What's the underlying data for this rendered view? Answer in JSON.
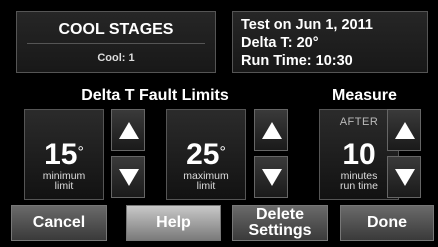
{
  "stages": {
    "title": "COOL STAGES",
    "subtitle": "Cool: 1"
  },
  "info": {
    "line1": "Test on Jun 1, 2011",
    "line2": "Delta T: 20°",
    "line3": "Run Time: 10:30"
  },
  "fault_limits": {
    "title": "Delta T Fault Limits",
    "min": {
      "value": "15",
      "unit": "°",
      "caption1": "minimum",
      "caption2": "limit"
    },
    "max": {
      "value": "25",
      "unit": "°",
      "caption1": "maximum",
      "caption2": "limit"
    }
  },
  "measure": {
    "title": "Measure",
    "prefix": "AFTER",
    "value": "10",
    "caption1": "minutes",
    "caption2": "run time"
  },
  "buttons": {
    "cancel": "Cancel",
    "help": "Help",
    "delete_line1": "Delete",
    "delete_line2": "Settings",
    "done": "Done"
  },
  "icons": {
    "up": "up-arrow-icon",
    "down": "down-arrow-icon"
  }
}
